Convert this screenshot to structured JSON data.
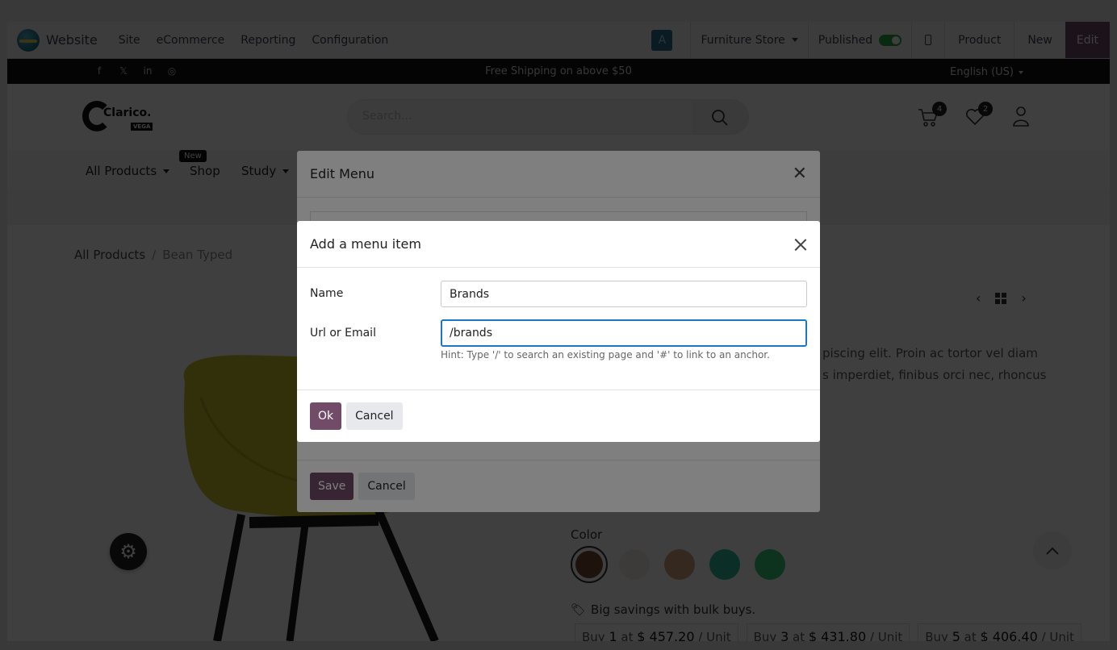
{
  "odoo_nav": {
    "brand": "Website",
    "menus": [
      "Site",
      "eCommerce",
      "Reporting",
      "Configuration"
    ],
    "avatar_letter": "A",
    "website_selector": "Furniture Store",
    "published_label": "Published",
    "product_btn": "Product",
    "new_btn": "New",
    "edit_btn": "Edit"
  },
  "announcement": {
    "promo": "Free Shipping on above $50",
    "language": "English (US)"
  },
  "header": {
    "logo_text": "Clarico.",
    "logo_sub": "VEGA",
    "search_placeholder": "Search...",
    "cart_count": "4",
    "wishlist_count": "2"
  },
  "catnav": {
    "items": [
      "All Products",
      "Shop",
      "Study"
    ],
    "new_tag": "New"
  },
  "breadcrumb": {
    "root": "All Products",
    "sep": "/",
    "current": "Bean Typed"
  },
  "product": {
    "desc_line1": "piscing elit. Proin ac tortor vel diam",
    "desc_line2": "s imperdiet, finibus orci nec, rhoncus",
    "color_label": "Color",
    "bulk_text": "Big savings with bulk buys.",
    "tiers": [
      {
        "pre": "Buy ",
        "qty": "1",
        "mid": " at ",
        "price": "$ 457.20",
        "unit": " / Unit"
      },
      {
        "pre": "Buy ",
        "qty": "3",
        "mid": " at ",
        "price": "$ 431.80",
        "unit": " / Unit"
      },
      {
        "pre": "Buy ",
        "qty": "5",
        "mid": " at ",
        "price": "$ 406.40",
        "unit": " / Unit"
      }
    ],
    "swatch_colors": [
      "#7b4a32",
      "#f3efe6",
      "#d7a57c",
      "#2fb89c",
      "#37c978"
    ]
  },
  "edit_menu": {
    "title": "Edit Menu",
    "save": "Save",
    "cancel": "Cancel"
  },
  "add_item": {
    "title": "Add a menu item",
    "name_label": "Name",
    "name_value": "Brands",
    "url_label": "Url or Email",
    "url_value": "/brands",
    "hint": "Hint: Type '/' to search an existing page and '#' to link to an anchor.",
    "ok": "Ok",
    "cancel": "Cancel"
  },
  "colors": {
    "primary": "#714b67",
    "focus": "#1b76c4",
    "toggle_on": "#28a745"
  }
}
